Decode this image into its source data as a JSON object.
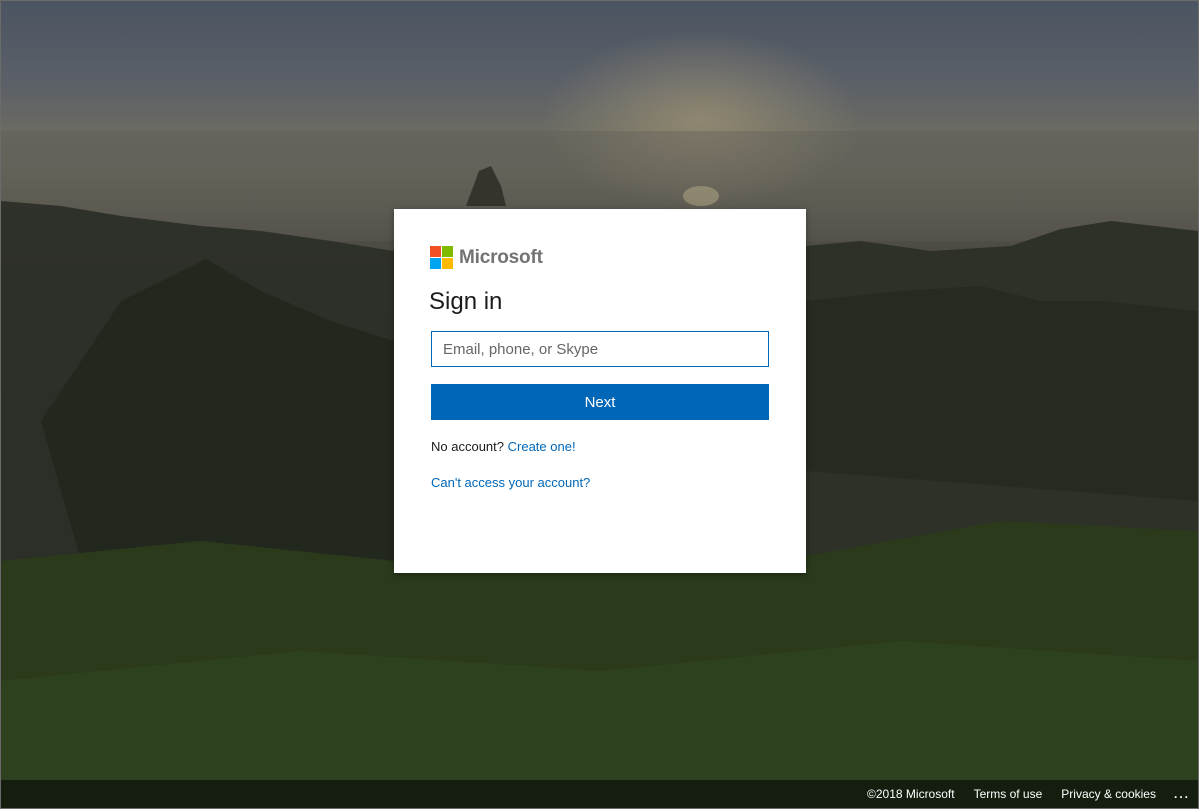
{
  "brand": {
    "name": "Microsoft",
    "logo_colors": [
      "#f25022",
      "#7fba00",
      "#00a4ef",
      "#ffb900"
    ]
  },
  "signin": {
    "title": "Sign in",
    "email_placeholder": "Email, phone, or Skype",
    "email_value": "",
    "next_label": "Next",
    "no_account_text": "No account?",
    "create_link": "Create one!",
    "cant_access_link": "Can't access your account?"
  },
  "footer": {
    "copyright": "©2018 Microsoft",
    "terms": "Terms of use",
    "privacy": "Privacy & cookies",
    "more": "..."
  },
  "colors": {
    "accent": "#0067b8",
    "card_bg": "#ffffff"
  }
}
